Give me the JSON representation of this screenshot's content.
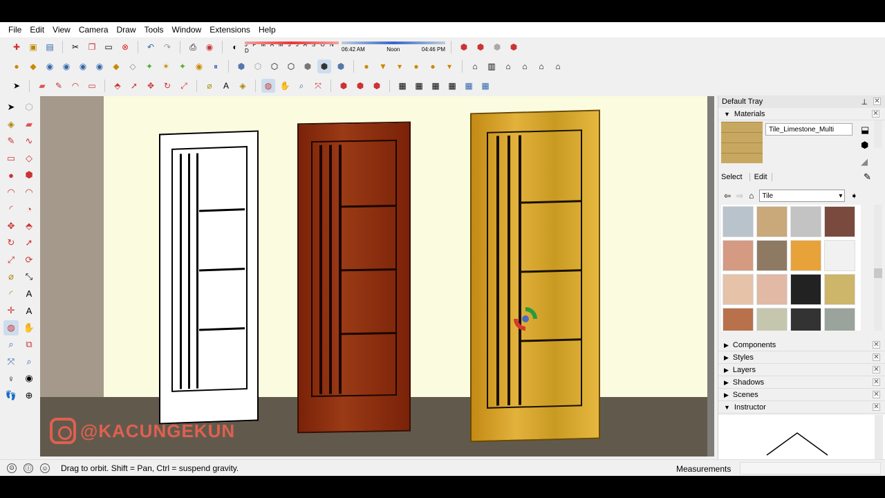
{
  "menu": [
    "File",
    "Edit",
    "View",
    "Camera",
    "Draw",
    "Tools",
    "Window",
    "Extensions",
    "Help"
  ],
  "shadow_bar": {
    "months": "J F M A M J J A S O N D",
    "time_start": "06:42 AM",
    "time_mid": "Noon",
    "time_end": "04:46 PM"
  },
  "watermark": "@KACUNGEKUN",
  "tray": {
    "title": "Default Tray",
    "materials_label": "Materials",
    "material_name": "Tile_Limestone_Multi",
    "tab_select": "Select",
    "tab_edit": "Edit",
    "collection": "Tile",
    "swatch_colors": [
      "#b9c3cc",
      "#c9a879",
      "#c3c3c3",
      "#7a4a3e",
      "#d49a82",
      "#8e7a62",
      "#e8a23a",
      "#f1f1f1",
      "#e6c2a8",
      "#e1b9a4",
      "#222222",
      "#cdb56a",
      "#b8714a",
      "#c5c6ae",
      "#333333",
      "#9aa39c"
    ],
    "sections": [
      {
        "label": "Components"
      },
      {
        "label": "Styles"
      },
      {
        "label": "Layers"
      },
      {
        "label": "Shadows"
      },
      {
        "label": "Scenes"
      },
      {
        "label": "Instructor"
      }
    ]
  },
  "status": {
    "message": "Drag to orbit. Shift = Pan, Ctrl = suspend gravity.",
    "measurements_label": "Measurements"
  },
  "colors": {
    "door1": "#ffffff",
    "door2": "#8a2a10",
    "door3": "#d6a124",
    "wall": "#fbfbe0",
    "floor": "#615a4c"
  }
}
